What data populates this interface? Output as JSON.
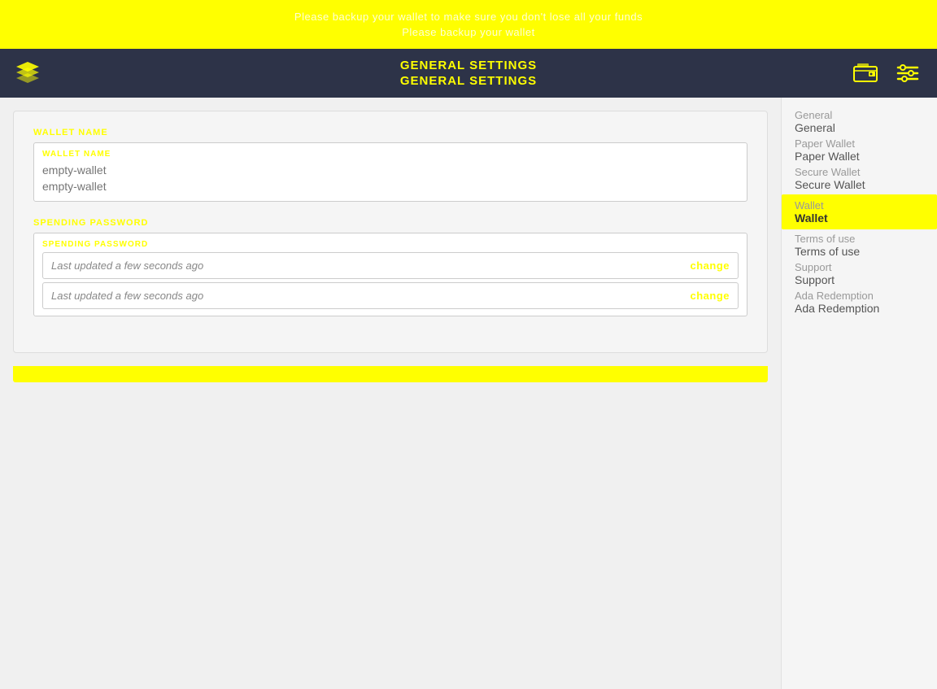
{
  "topBanner": {
    "line1": "Please backup your wallet to make sure you don't lose all your funds",
    "line2": "Please backup your wallet"
  },
  "navbar": {
    "title_line1": "GENERAL SETTINGS",
    "title_line2": "GENERAL SETTINGS",
    "logoAlt": "Daedalus logo"
  },
  "sidebar": {
    "items": [
      {
        "id": "general",
        "label": "General",
        "shadow": "General",
        "active": false
      },
      {
        "id": "paper-wallet",
        "label": "Paper Wallet",
        "shadow": "Paper Wallet",
        "active": false
      },
      {
        "id": "secure-wallet",
        "label": "Secure Wallet",
        "shadow": "Secure Wallet",
        "active": false
      },
      {
        "id": "wallet",
        "label": "Wallet",
        "shadow": "Wallet",
        "active": true
      },
      {
        "id": "terms-of-use",
        "label": "Terms of use",
        "shadow": "Terms of use",
        "active": false
      },
      {
        "id": "support",
        "label": "Support",
        "shadow": "Support",
        "active": false
      },
      {
        "id": "ada-redemption",
        "label": "Ada Redemption",
        "shadow": "Ada Redemption",
        "active": false
      }
    ]
  },
  "walletNameField": {
    "label": "WALLET NAME",
    "inputLabel": "WALLET NAME",
    "placeholder1": "empty-wallet",
    "placeholder2": "empty-wallet"
  },
  "spendingPasswordField": {
    "label": "SPENDING PASSWORD",
    "inputLabel": "SPENDING PASSWORD",
    "lastUpdated1": "Last updated a few seconds ago",
    "lastUpdated2": "Last updated a few seconds ago",
    "changeBtn1": "change",
    "changeBtn2": "change"
  },
  "colors": {
    "yellow": "#ffff00",
    "navBg": "#2d3348",
    "activeItem": "#ffff00"
  }
}
